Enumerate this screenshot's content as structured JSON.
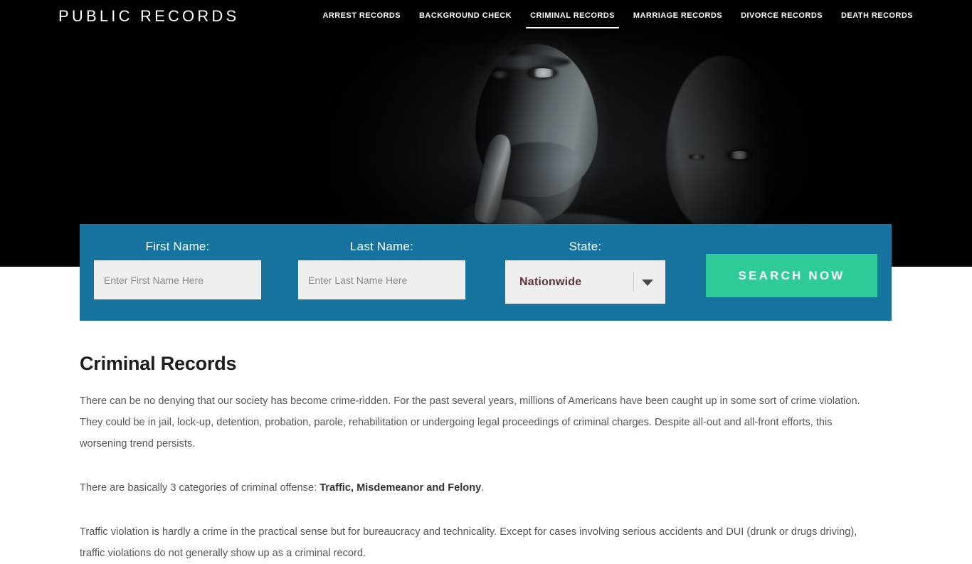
{
  "header": {
    "brand": "PUBLIC RECORDS",
    "nav": [
      {
        "label": "ARREST RECORDS",
        "active": false
      },
      {
        "label": "BACKGROUND CHECK",
        "active": false
      },
      {
        "label": "CRIMINAL RECORDS",
        "active": true
      },
      {
        "label": "MARRIAGE RECORDS",
        "active": false
      },
      {
        "label": "DIVORCE RECORDS",
        "active": false
      },
      {
        "label": "DEATH RECORDS",
        "active": false
      }
    ]
  },
  "search": {
    "first_name_label": "First Name:",
    "first_name_placeholder": "Enter First Name Here",
    "first_name_value": "",
    "last_name_label": "Last Name:",
    "last_name_placeholder": "Enter Last Name Here",
    "last_name_value": "",
    "state_label": "State:",
    "state_value": "Nationwide",
    "submit_label": "SEARCH NOW",
    "panel_color": "#17749f",
    "submit_color": "#2ecb99",
    "state_value_color": "#5c3339"
  },
  "main": {
    "title": "Criminal Records",
    "paragraph_1": "There can be no denying that our society has become crime-ridden. For the past several years, millions of Americans have been caught up in some sort of crime violation. They could be in jail, lock-up, detention, probation, parole, rehabilitation or undergoing legal proceedings of criminal charges. Despite all-out and all-front efforts, this worsening trend persists.",
    "paragraph_2_prefix": "There are basically 3 categories of criminal offense: ",
    "paragraph_2_bold": "Traffic, Misdemeanor and Felony",
    "paragraph_2_suffix": ".",
    "paragraph_3": "Traffic violation is hardly a crime in the practical sense but for bureaucracy and technicality. Except for cases involving serious accidents and DUI (drunk or drugs driving), traffic violations do not generally show up as a criminal record."
  }
}
